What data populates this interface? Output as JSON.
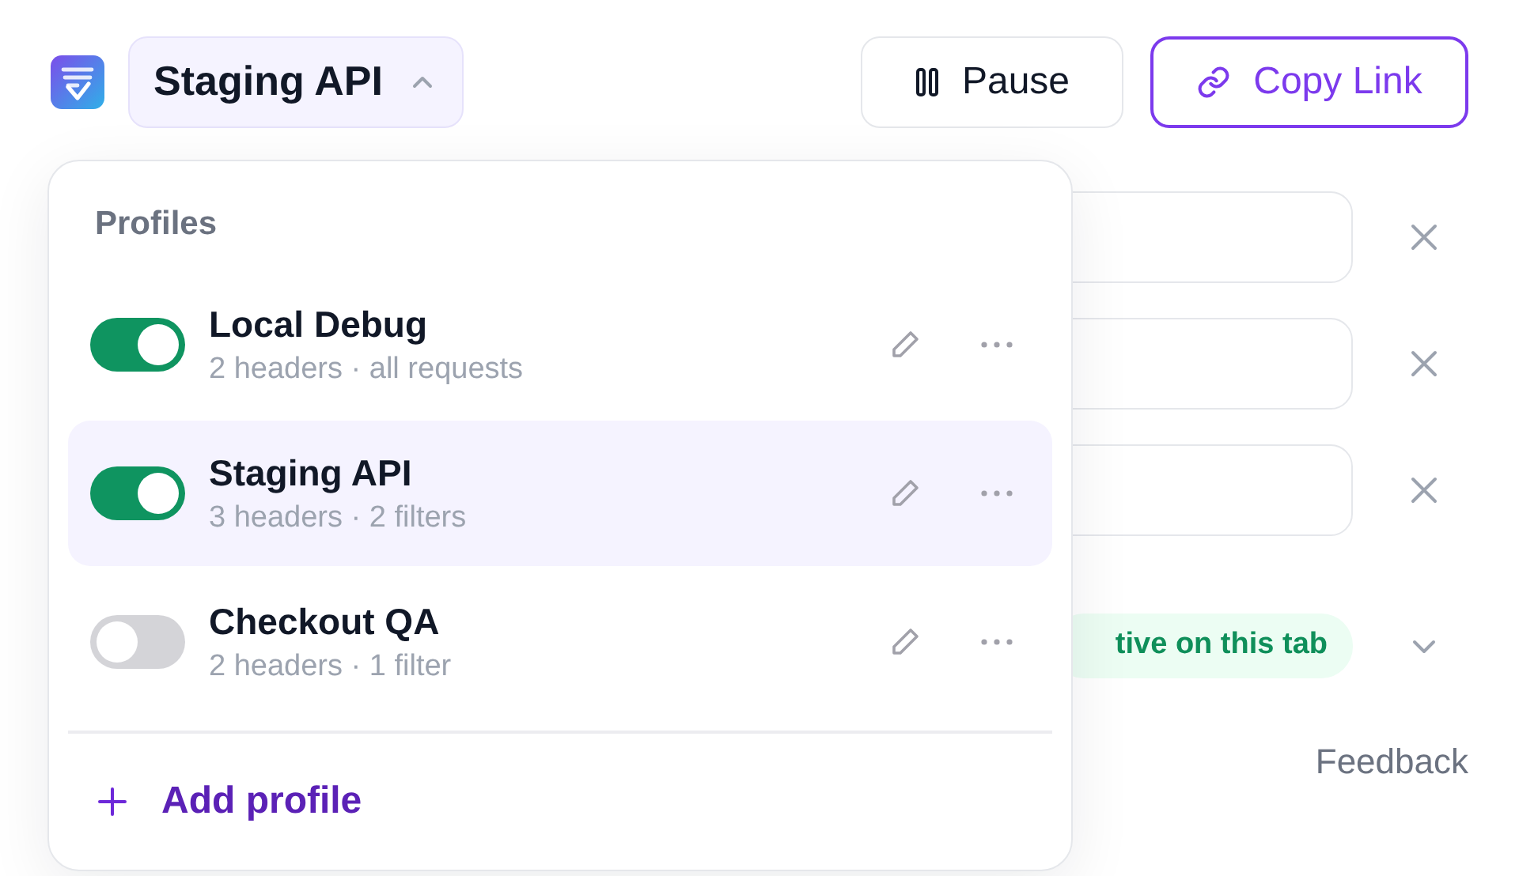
{
  "header": {
    "profile_selector": {
      "label": "Staging API",
      "expanded": true
    },
    "buttons": [
      {
        "kind": "pause",
        "label": "Pause"
      },
      {
        "kind": "copy_link",
        "label": "Copy Link"
      }
    ]
  },
  "profiles_menu": {
    "title": "Profiles",
    "profiles": [
      {
        "name": "Local Debug",
        "summary": "2 headers · all requests",
        "on": true,
        "selected": false
      },
      {
        "name": "Staging API",
        "summary": "3 headers · 2 filters",
        "on": true,
        "selected": true
      },
      {
        "name": "Checkout QA",
        "summary": "2 headers · 1 filter",
        "on": false,
        "selected": false
      }
    ],
    "add_label": "Add profile"
  },
  "status_badge": "tive on this tab",
  "feedback": "Feedback"
}
